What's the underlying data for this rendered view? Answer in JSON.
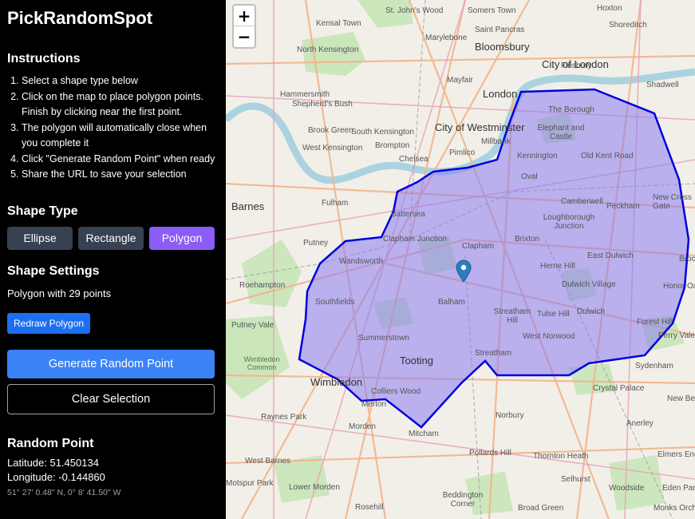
{
  "app": {
    "title": "PickRandomSpot"
  },
  "instructions": {
    "heading": "Instructions",
    "steps": [
      "Select a shape type below",
      "Click on the map to place polygon points. Finish by clicking near the first point.",
      "The polygon will automatically close when you complete it",
      "Click \"Generate Random Point\" when ready",
      "Share the URL to save your selection"
    ]
  },
  "shape_type": {
    "heading": "Shape Type",
    "buttons": [
      "Ellipse",
      "Rectangle",
      "Polygon"
    ],
    "selected": "Polygon"
  },
  "shape_settings": {
    "heading": "Shape Settings",
    "text": "Polygon with 29 points",
    "redraw_label": "Redraw Polygon"
  },
  "actions": {
    "generate_label": "Generate Random Point",
    "clear_label": "Clear Selection"
  },
  "random_point": {
    "heading": "Random Point",
    "latitude": "Latitude: 51.450134",
    "longitude": "Longitude: -0.144860",
    "dms": "51° 27' 0.48\" N, 0° 8' 41.50\" W"
  },
  "map": {
    "zoom_in": "+",
    "zoom_out": "−",
    "polygon_color": "#0000e0",
    "polygon_fill": "#8b7bf0",
    "marker_color": "#2e7dc2",
    "marker_icon": "map-pin-icon",
    "places": {
      "st_johns_wood": "St. John's Wood",
      "somers_town": "Somers Town",
      "hoxton": "Hoxton",
      "kensal_town": "Kensal Town",
      "marylebone": "Marylebone",
      "saint_pancras": "Saint Pancras",
      "shoreditch": "Shoreditch",
      "north_kensington": "North Kensington",
      "bloomsbury": "Bloomsbury",
      "finsbury": "Finsbury",
      "city_of_london": "City of London",
      "mayfair": "Mayfair",
      "hammersmith": "Hammersmith",
      "shepherds_bush": "Shepherd's Bush",
      "london": "London",
      "shadwell": "Shadwell",
      "city_of_westminster": "City of Westminster",
      "the_borough": "The Borough",
      "brook_green": "Brook Green",
      "south_kensington": "South Kensington",
      "elephant_and_castle": "Elephant and Castle",
      "west_kensington": "West Kensington",
      "brompton": "Brompton",
      "pimlico": "Pimlico",
      "millbank": "Millbank",
      "kennington": "Kennington",
      "old_kent_road": "Old Kent Road",
      "chelsea": "Chelsea",
      "oval": "Oval",
      "barnes": "Barnes",
      "fulham": "Fulham",
      "battersea": "Battersea",
      "camberwell": "Camberwell",
      "peckham": "Peckham",
      "new_cross_gate": "New Cross Gate",
      "putney": "Putney",
      "clapham_junction": "Clapham Junction",
      "brixton": "Brixton",
      "loughborough_junction": "Loughborough Junction",
      "wandsworth": "Wandsworth",
      "clapham": "Clapham",
      "herne_hill": "Herne Hill",
      "east_dulwich": "East Dulwich",
      "brockley": "Brockl",
      "roehampton": "Roehampton",
      "dulwich_village": "Dulwich Village",
      "honor_oak": "Honor Oak",
      "southfields": "Southfields",
      "balham": "Balham",
      "streatham_hill": "Streatham Hill",
      "tulse_hill": "Tulse Hill",
      "dulwich": "Dulwich",
      "putney_vale": "Putney Vale",
      "forest_hill": "Forest Hill",
      "summerstown": "Summerstown",
      "west_norwood": "West Norwood",
      "perry_vale": "Perry Vale",
      "wimbledon_common": "Wimbledon Common",
      "tooting": "Tooting",
      "streatham": "Streatham",
      "sydenham": "Sydenham",
      "wimbledon": "Wimbledon",
      "crystal_palace": "Crystal Palace",
      "colliers_wood": "Colliers Wood",
      "merton": "Merton",
      "new_beckenham": "New Beckenham",
      "raynes_park": "Raynes Park",
      "norbury": "Norbury",
      "morden": "Morden",
      "mitcham": "Mitcham",
      "anerley": "Anerley",
      "west_barnes": "West Barnes",
      "pollards_hill": "Pollards Hill",
      "thornton_heath": "Thornton Heath",
      "elmers_end": "Elmers End",
      "motspur_park": "Motspur Park",
      "lower_morden": "Lower Morden",
      "selhurst": "Selhurst",
      "woodside": "Woodside",
      "eden_park": "Eden Park",
      "rosehill": "Rosehill",
      "beddington_corner": "Beddington Corner",
      "broad_green": "Broad Green",
      "monks_orchard": "Monks Orchard"
    }
  }
}
